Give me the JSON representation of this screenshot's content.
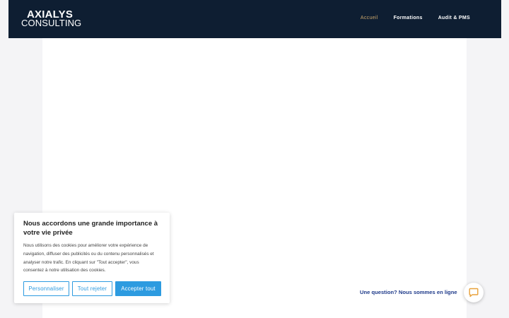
{
  "header": {
    "logo_top": "AXIALYS",
    "logo_bottom": "CONSULTING",
    "nav": [
      {
        "label": "Accueil",
        "active": true
      },
      {
        "label": "Formations",
        "active": false
      },
      {
        "label": "Audit & PMS",
        "active": false
      }
    ]
  },
  "cookie_banner": {
    "title": "Nous accordons une grande importance à votre vie privée",
    "text": "Nous utilisons des cookies pour améliorer votre expérience de navigation, diffuser des publicités ou du contenu personnalisés et analyser notre trafic. En cliquant sur \"Tout accepter\", vous consentez à notre utilisation des cookies.",
    "buttons": {
      "customize": "Personnaliser",
      "reject": "Tout rejeter",
      "accept": "Accepter tout"
    }
  },
  "chat": {
    "label": "Une question? Nous sommes en ligne",
    "icon": "chat-bubble-icon"
  },
  "colors": {
    "header_bg": "#0e1e32",
    "accent": "#2d9be0",
    "nav_active": "#c8a46a",
    "chat_text": "#1e3a8a",
    "chat_icon": "#e8a13a"
  }
}
